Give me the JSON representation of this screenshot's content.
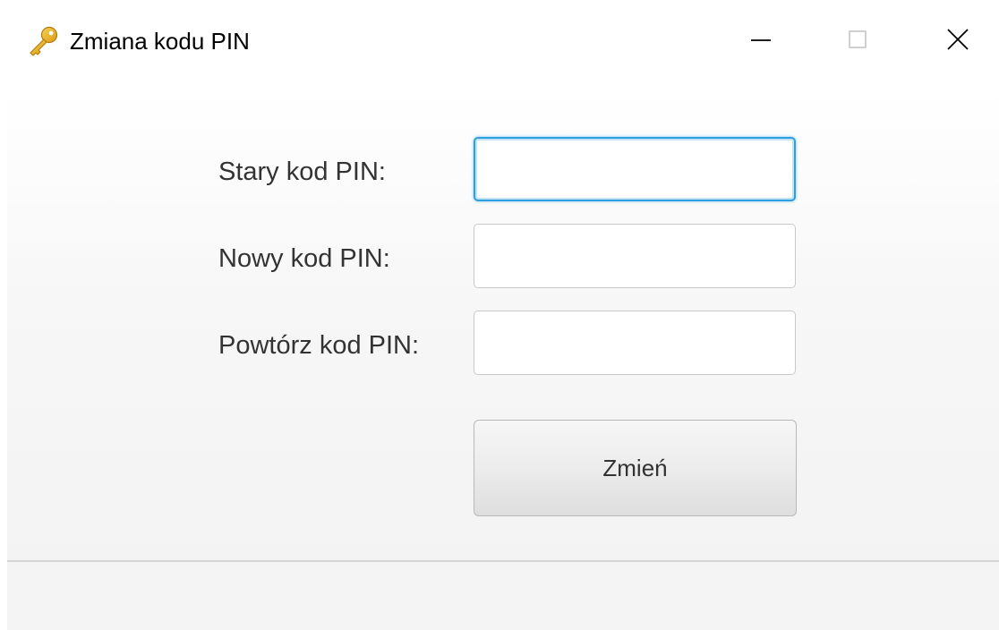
{
  "window": {
    "title": "Zmiana kodu PIN",
    "icon": "key-icon",
    "controls": [
      "minimize-icon",
      "maximize-icon",
      "close-icon"
    ]
  },
  "form": {
    "old_pin_label": "Stary kod PIN:",
    "old_pin_value": "",
    "new_pin_label": "Nowy kod PIN:",
    "new_pin_value": "",
    "repeat_pin_label": "Powtórz kod PIN:",
    "repeat_pin_value": "",
    "submit_label": "Zmień"
  },
  "colors": {
    "focus_border": "#2f9fe0",
    "key_icon": "#e8b21a"
  }
}
